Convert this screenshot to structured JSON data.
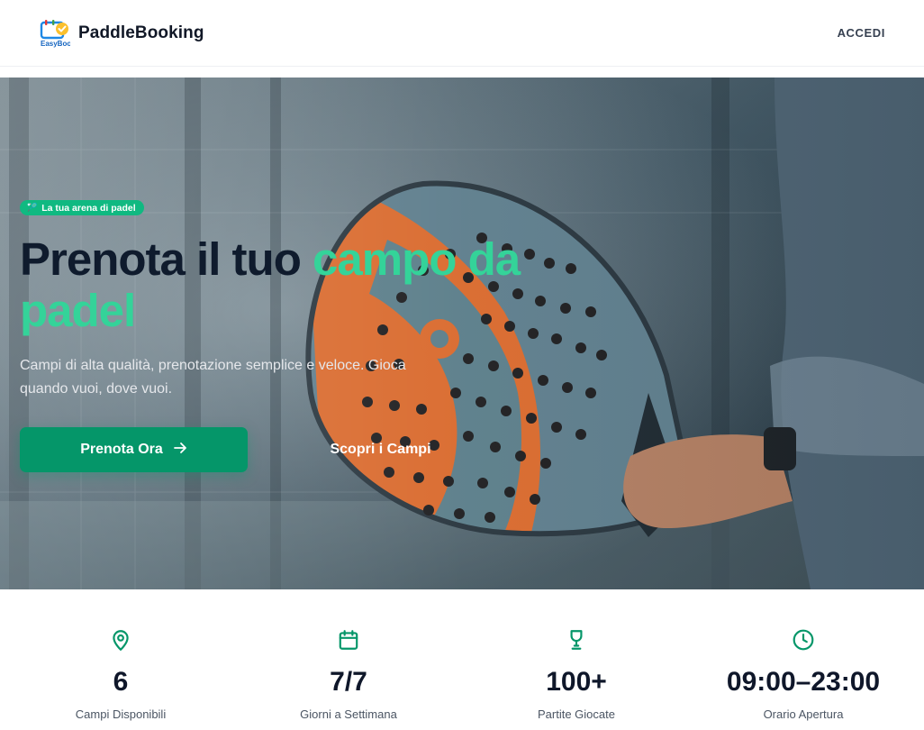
{
  "navbar": {
    "brand_name": "PaddleBooking",
    "logo_text": "EasyBook",
    "login_label": "ACCEDI"
  },
  "hero": {
    "tag_label": "La tua arena di padel",
    "title_part1": "Prenota il tuo ",
    "title_accent": "campo da padel",
    "subtitle": "Campi di alta qualità, prenotazione semplice e veloce. Gioca quando vuoi, dove vuoi.",
    "primary_button": "Prenota Ora",
    "secondary_button": "Scopri i Campi"
  },
  "stats": [
    {
      "icon": "map-pin-icon",
      "value": "6",
      "label": "Campi Disponibili"
    },
    {
      "icon": "calendar-icon",
      "value": "7/7",
      "label": "Giorni a Settimana"
    },
    {
      "icon": "trophy-icon",
      "value": "100+",
      "label": "Partite Giocate"
    },
    {
      "icon": "clock-icon",
      "value": "09:00–23:00",
      "label": "Orario Apertura"
    }
  ],
  "colors": {
    "accent": "#10b981",
    "primary_button": "#059669",
    "title_dark": "#0f1b2d",
    "title_accent": "#34d399"
  }
}
